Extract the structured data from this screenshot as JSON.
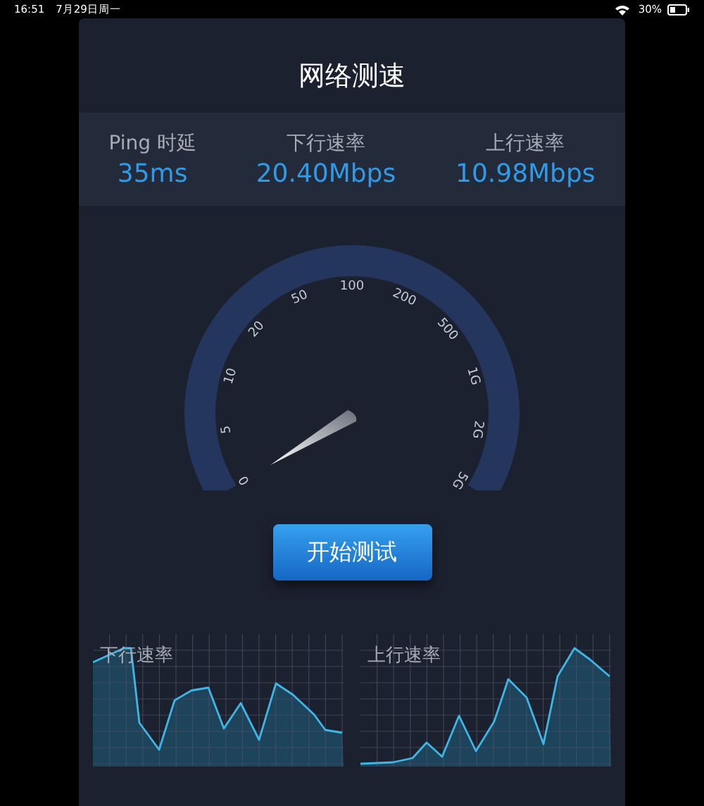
{
  "status_bar": {
    "time": "16:51",
    "date": "7月29日周一",
    "battery": "30%"
  },
  "title": "网络测速",
  "stats": [
    {
      "label": "Ping 时延",
      "value": "35ms"
    },
    {
      "label": "下行速率",
      "value": "20.40Mbps"
    },
    {
      "label": "上行速率",
      "value": "10.98Mbps"
    }
  ],
  "gauge": {
    "labels": [
      "0",
      "5",
      "10",
      "20",
      "50",
      "100",
      "200",
      "500",
      "1G",
      "2G",
      "5G"
    ]
  },
  "start_button": "开始测试",
  "charts": [
    {
      "label": "下行速率"
    },
    {
      "label": "上行速率"
    }
  ]
}
